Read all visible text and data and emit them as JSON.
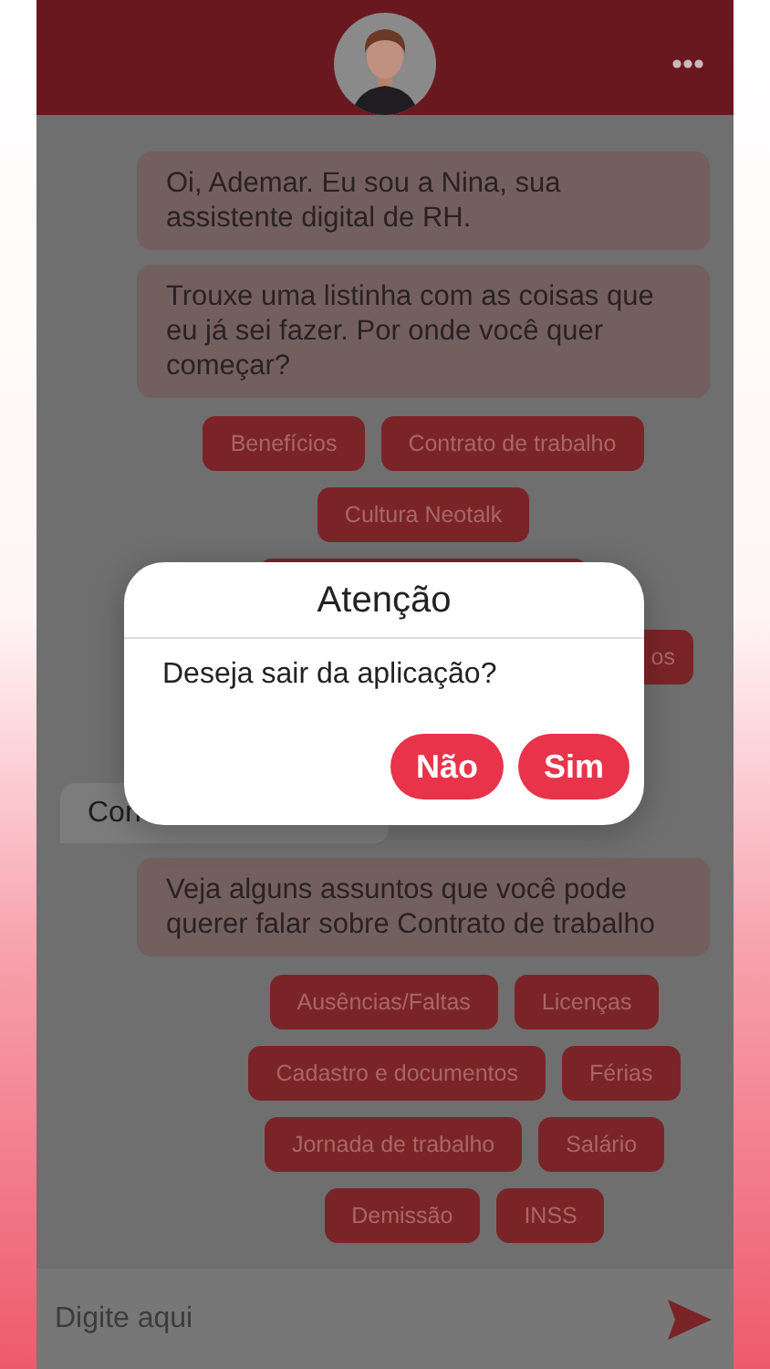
{
  "messages": [
    {
      "kind": "bot",
      "text": "Oi, Ademar. Eu sou a Nina, sua assistente digital de RH."
    },
    {
      "kind": "bot",
      "text": "Trouxe uma listinha com as coisas que eu já sei fazer. Por onde você quer começar?"
    },
    {
      "kind": "chips",
      "rows": [
        [
          {
            "kind": "option",
            "label": "Benefícios"
          },
          {
            "kind": "option",
            "label": "Contrato de trabalho"
          }
        ],
        [
          {
            "kind": "option",
            "label": "Cultura Neotalk"
          }
        ],
        [
          {
            "kind": "covered"
          }
        ],
        [
          {
            "kind": "partial",
            "label": "os"
          }
        ]
      ]
    },
    {
      "kind": "user",
      "text": "Con"
    },
    {
      "kind": "bot",
      "text": "Veja alguns assuntos que você pode querer falar sobre Contrato de trabalho"
    },
    {
      "kind": "chips",
      "rows": [
        [
          {
            "kind": "option",
            "label": "Ausências/Faltas"
          },
          {
            "kind": "option",
            "label": "Licenças"
          }
        ],
        [
          {
            "kind": "option",
            "label": "Cadastro e documentos"
          },
          {
            "kind": "option",
            "label": "Férias"
          }
        ],
        [
          {
            "kind": "option",
            "label": "Jornada de trabalho"
          },
          {
            "kind": "option",
            "label": "Salário"
          }
        ],
        [
          {
            "kind": "option",
            "label": "Demissão"
          },
          {
            "kind": "option",
            "label": "INSS"
          }
        ]
      ]
    }
  ],
  "input": {
    "placeholder": "Digite aqui"
  },
  "dialog": {
    "title": "Atenção",
    "message": "Deseja sair da aplicação?",
    "buttons": [
      "Não",
      "Sim"
    ]
  }
}
